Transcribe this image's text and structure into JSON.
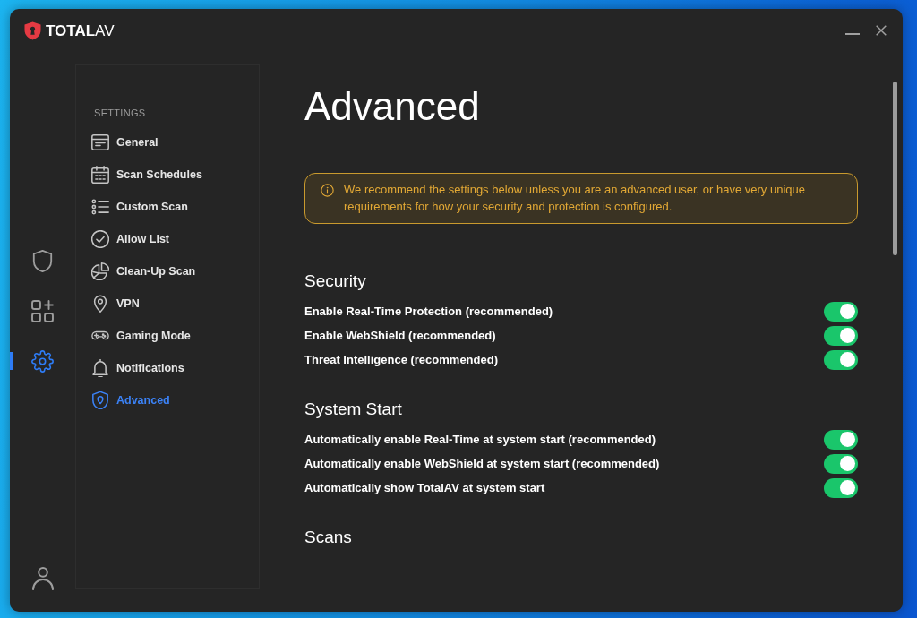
{
  "window": {
    "brand": "**TOTAL**AV"
  },
  "rail": {
    "items": [
      {
        "kind": "shield",
        "selected": false
      },
      {
        "kind": "apps",
        "selected": false
      },
      {
        "kind": "gear",
        "selected": true
      }
    ]
  },
  "settings_menu": {
    "heading": "SETTINGS",
    "items": [
      {
        "label": "General",
        "kind": "window",
        "selected": false
      },
      {
        "label": "Scan Schedules",
        "kind": "calendar",
        "selected": false
      },
      {
        "label": "Custom Scan",
        "kind": "list",
        "selected": false
      },
      {
        "label": "Allow List",
        "kind": "check",
        "selected": false
      },
      {
        "label": "Clean-Up Scan",
        "kind": "pie",
        "selected": false
      },
      {
        "label": "VPN",
        "kind": "pin",
        "selected": false
      },
      {
        "label": "Gaming Mode",
        "kind": "gamepad",
        "selected": false
      },
      {
        "label": "Notifications",
        "kind": "bell",
        "selected": false
      },
      {
        "label": "Advanced",
        "kind": "shield",
        "selected": true
      }
    ]
  },
  "page": {
    "title": "Advanced",
    "notice": "We recommend the settings below unless you are an advanced user, or have very unique requirements for how your security and protection is configured.",
    "sections": [
      {
        "heading": "Security",
        "settings": [
          {
            "label": "Enable Real-Time Protection (recommended)",
            "on": true
          },
          {
            "label": "Enable WebShield (recommended)",
            "on": true
          },
          {
            "label": "Threat Intelligence (recommended)",
            "on": true
          }
        ]
      },
      {
        "heading": "System Start",
        "settings": [
          {
            "label": "Automatically enable Real-Time at system start (recommended)",
            "on": true
          },
          {
            "label": "Automatically enable WebShield at system start (recommended)",
            "on": true
          },
          {
            "label": "Automatically show TotalAV at system start",
            "on": true
          }
        ]
      },
      {
        "heading": "Scans"
      }
    ]
  }
}
